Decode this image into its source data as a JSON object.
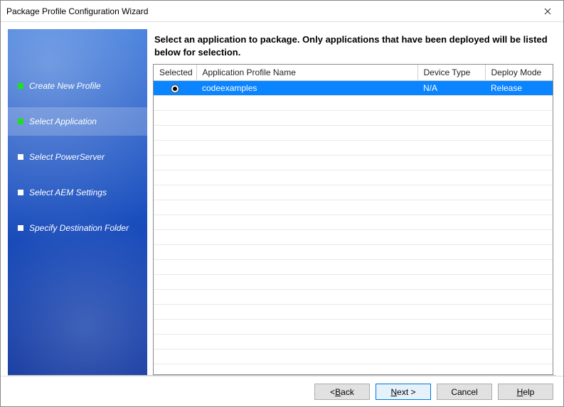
{
  "window": {
    "title": "Package Profile Configuration Wizard"
  },
  "sidebar": {
    "steps": [
      {
        "label": "Create New Profile",
        "done": true,
        "active": false
      },
      {
        "label": "Select Application",
        "done": true,
        "active": true
      },
      {
        "label": "Select PowerServer",
        "done": false,
        "active": false
      },
      {
        "label": "Select AEM Settings",
        "done": false,
        "active": false
      },
      {
        "label": "Specify Destination Folder",
        "done": false,
        "active": false
      }
    ]
  },
  "main": {
    "instruction": "Select an application to package. Only applications that have been deployed will be listed below for selection.",
    "columns": {
      "selected": "Selected",
      "app": "Application Profile Name",
      "device": "Device Type",
      "deploy": "Deploy Mode"
    },
    "rows": [
      {
        "selected": true,
        "app": "codeexamples",
        "device": "N/A",
        "deploy": "Release"
      }
    ],
    "empty_row_count": 18
  },
  "footer": {
    "back_prefix": "< ",
    "back_m": "B",
    "back_suffix": "ack",
    "next_m": "N",
    "next_suffix": "ext >",
    "cancel": "Cancel",
    "help_m": "H",
    "help_suffix": "elp"
  }
}
